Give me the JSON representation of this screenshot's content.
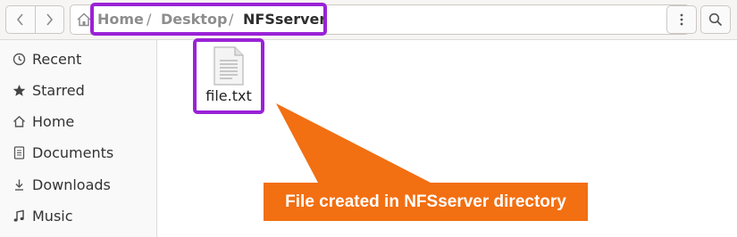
{
  "header": {
    "back_icon": "chevron-left-icon",
    "forward_icon": "chevron-right-icon",
    "menu_icon": "vertical-dots-icon",
    "search_icon": "search-icon",
    "breadcrumb": {
      "home_icon": "home-icon",
      "items": [
        "Home",
        "Desktop",
        "NFSserver"
      ],
      "separator": "/"
    }
  },
  "sidebar": {
    "items": [
      {
        "label": "Recent",
        "icon": "clock-icon"
      },
      {
        "label": "Starred",
        "icon": "star-icon"
      },
      {
        "label": "Home",
        "icon": "home-icon"
      },
      {
        "label": "Documents",
        "icon": "document-icon"
      },
      {
        "label": "Downloads",
        "icon": "download-icon"
      },
      {
        "label": "Music",
        "icon": "music-icon"
      }
    ]
  },
  "files": [
    {
      "name": "file.txt",
      "icon": "text-file-icon"
    }
  ],
  "annotation": {
    "text": "File created in NFSserver directory",
    "color": "#f26f12",
    "highlight_color": "#9a22d6"
  }
}
